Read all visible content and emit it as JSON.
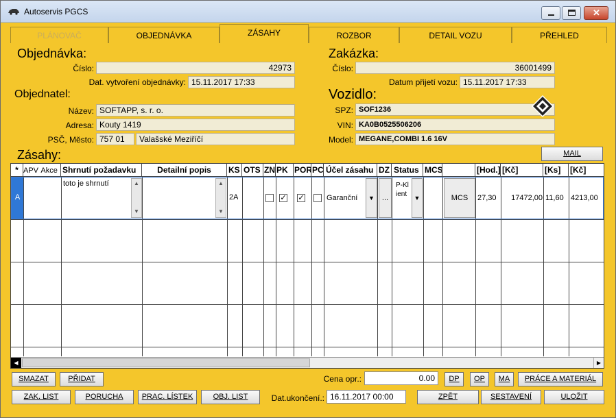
{
  "window": {
    "title": "Autoservis PGCS"
  },
  "tabs": [
    {
      "label": "PLÁNOVAČ",
      "state": "disabled"
    },
    {
      "label": "OBJEDNÁVKA",
      "state": "normal"
    },
    {
      "label": "ZÁSAHY",
      "state": "active"
    },
    {
      "label": "ROZBOR",
      "state": "normal"
    },
    {
      "label": "DETAIL VOZU",
      "state": "normal"
    },
    {
      "label": "PŘEHLED",
      "state": "normal"
    }
  ],
  "objednavka": {
    "heading": "Objednávka:",
    "cislo_label": "Číslo:",
    "cislo": "42973",
    "datum_label": "Dat. vytvoření objednávky:",
    "datum": "15.11.2017 17:33"
  },
  "objednatel": {
    "heading": "Objednatel:",
    "nazev_label": "Název:",
    "nazev": "SOFTAPP, s. r. o.",
    "adresa_label": "Adresa:",
    "adresa": "Kouty 1419",
    "psc_label": "PSČ, Město:",
    "psc": "757 01",
    "mesto": "Valašské Meziříčí"
  },
  "zakazka": {
    "heading": "Zakázka:",
    "cislo_label": "Číslo:",
    "cislo": "36001499",
    "datum_label": "Datum přijetí vozu:",
    "datum": "15.11.2017 17:33"
  },
  "vozidlo": {
    "heading": "Vozidlo:",
    "spz_label": "SPZ:",
    "spz": "SOF1236",
    "vin_label": "VIN:",
    "vin": "KA0B0525506206",
    "model_label": "Model:",
    "model": "MEGANE,COMBI 1.6 16V"
  },
  "zasahy": {
    "heading": "Zásahy:",
    "mail_button": "MAIL",
    "columns": [
      "*",
      "APV",
      "Akce",
      "Shrnutí požadavku",
      "Detailní popis",
      "KS",
      "OTS",
      "ZN",
      "PK",
      "POR",
      "PC",
      "Účel zásahu",
      "DZ",
      "Status",
      "MCS",
      "[Hod.]",
      "[Kč]",
      "[Ks]",
      "[Kč]"
    ],
    "row": {
      "marker": "A",
      "shrnuti": "toto je shrnutí",
      "ks": "2A",
      "ucel": "Garanční",
      "dz": "...",
      "status": "P-Kl\nient",
      "mcs_button": "MCS",
      "hod": "27,30",
      "kc1": "17472,00",
      "ks2": "11,60",
      "kc2": "4213,00",
      "zn": false,
      "pk": true,
      "por": true,
      "pc": false
    }
  },
  "footer": {
    "smazat": "SMAZAT",
    "pridat": "PŘIDAT",
    "cena_label": "Cena opr.:",
    "cena": "0.00",
    "dp": "DP",
    "op": "OP",
    "ma": "MA",
    "prace": "PRÁCE A MATERIÁL",
    "zak_list": "ZAK. LIST",
    "porucha": "PORUCHA",
    "prac_listek": "PRAC. LÍSTEK",
    "obj_list": "OBJ. LIST",
    "datukonceni_label": "Dat.ukončení.:",
    "datukonceni": "16.11.2017 00:00",
    "zpet": "ZPĚT",
    "sestaveni": "SESTAVENÍ",
    "ulozit": "ULOŽIT"
  }
}
